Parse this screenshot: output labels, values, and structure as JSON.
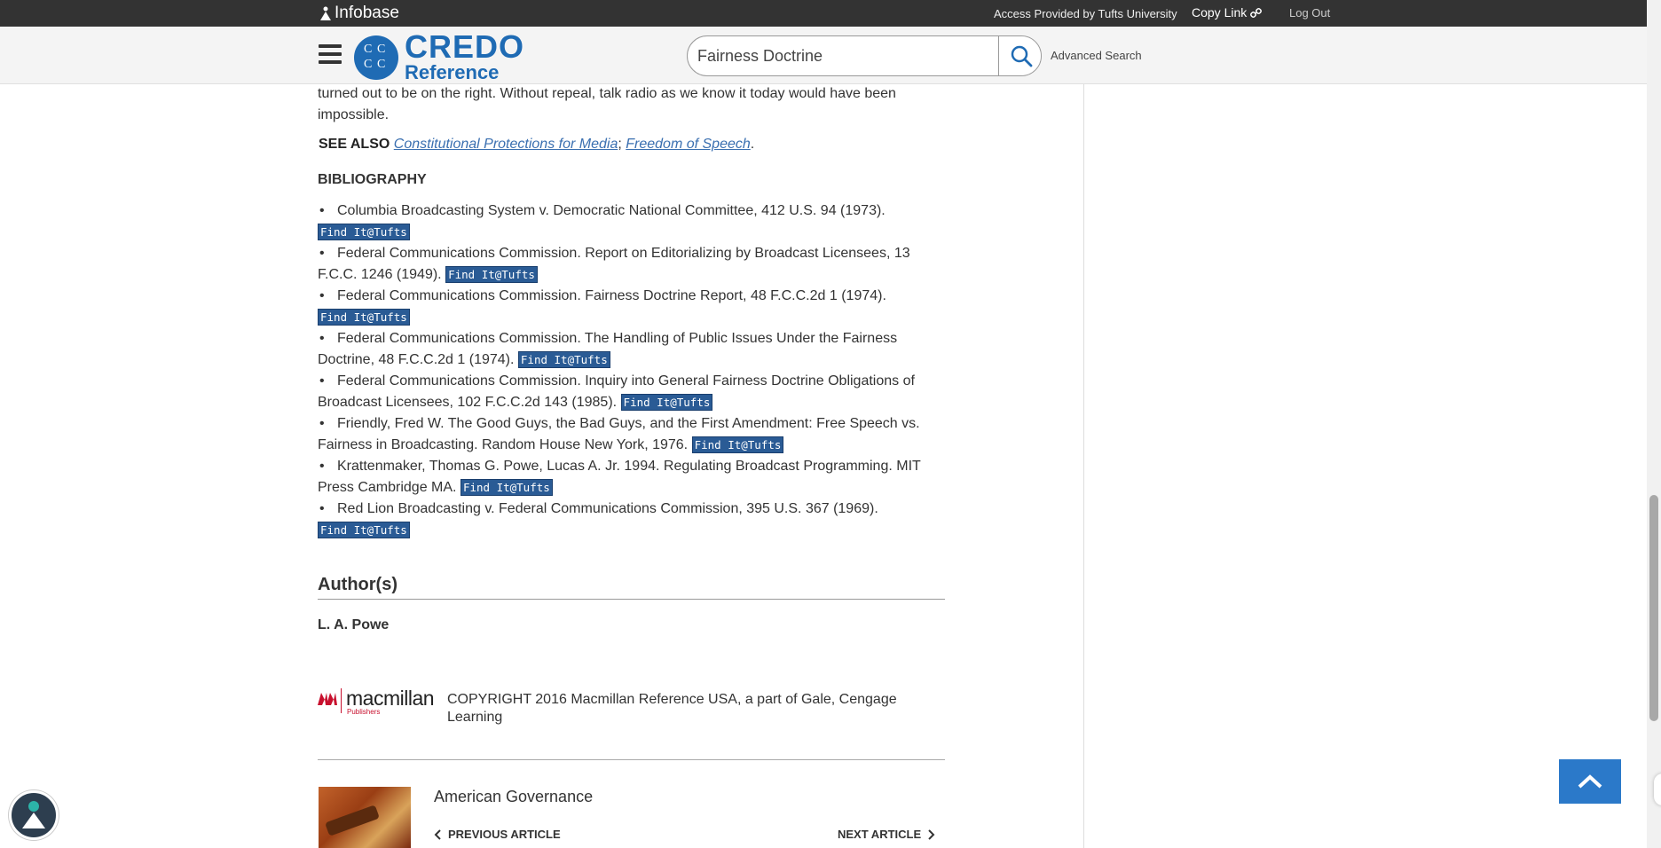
{
  "topbar": {
    "brand": "Infobase",
    "access_text": "Access Provided by Tufts University",
    "copy_link": "Copy Link",
    "log_out": "Log Out"
  },
  "header": {
    "logo_main": "CREDO",
    "logo_sub": "Reference",
    "search_value": "Fairness Doctrine",
    "advanced_search": "Advanced Search"
  },
  "article": {
    "paragraph_tail": "turned out to be on the right. Without repeal, talk radio as we know it today would have been impossible.",
    "see_also_label": "SEE ALSO",
    "see_also_links": [
      "Constitutional Protections for Media",
      "Freedom of Speech"
    ],
    "see_also_sep": ";",
    "see_also_end": ".",
    "bibliography_title": "BIBLIOGRAPHY",
    "finder_label": "Find It@Tufts",
    "bibliography": [
      "Columbia Broadcasting System v. Democratic National Committee, 412 U.S. 94 (1973).",
      "Federal Communications Commission. Report on Editorializing by Broadcast Licensees, 13 F.C.C. 1246 (1949).",
      "Federal Communications Commission. Fairness Doctrine Report, 48 F.C.C.2d 1 (1974).",
      "Federal Communications Commission. The Handling of Public Issues Under the Fairness Doctrine, 48 F.C.C.2d 1 (1974).",
      "Federal Communications Commission. Inquiry into General Fairness Doctrine Obligations of Broadcast Licensees, 102 F.C.C.2d 143 (1985).",
      "Friendly, Fred W. The Good Guys, the Bad Guys, and the First Amendment: Free Speech vs. Fairness in Broadcasting. Random House New York, 1976.",
      "Krattenmaker, Thomas G. Powe, Lucas A. Jr. 1994. Regulating Broadcast Programming. MIT Press Cambridge MA.",
      "Red Lion Broadcasting v. Federal Communications Commission, 395 U.S. 367 (1969)."
    ],
    "authors_title": "Author(s)",
    "author_name": "L. A. Powe",
    "publisher_name": "macmillan",
    "publisher_sub": "Publishers",
    "copyright": "COPYRIGHT 2016 Macmillan Reference USA, a part of Gale, Cengage Learning"
  },
  "footer_nav": {
    "book_title": "American Governance",
    "prev_label": "PREVIOUS ARTICLE",
    "next_label": "NEXT ARTICLE"
  },
  "colors": {
    "brand_blue": "#1f6bb4",
    "finder_blue": "#2a5b95",
    "link_blue": "#3a6fb0",
    "topbar": "#333333",
    "to_top": "#2b79c9"
  }
}
